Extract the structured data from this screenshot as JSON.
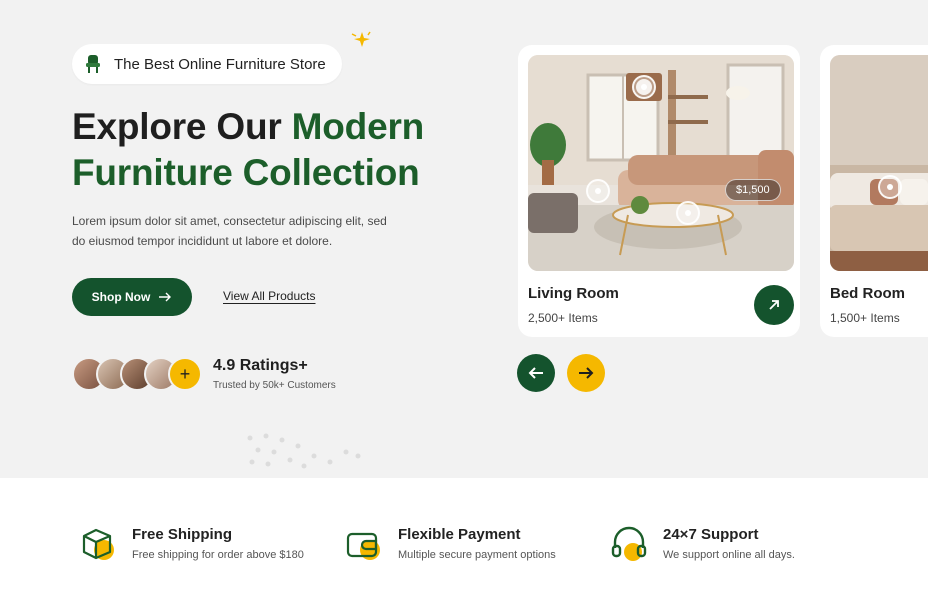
{
  "hero": {
    "badge": "The Best Online Furniture Store",
    "title_line1_plain": "Explore Our ",
    "title_line1_green": "Modern",
    "title_line2_green": "Furniture Collection",
    "description": "Lorem ipsum dolor sit amet, consectetur adipiscing elit, sed do eiusmod tempor incididunt ut labore et dolore.",
    "shop_button": "Shop Now",
    "view_link": "View All Products",
    "ratings_title": "4.9 Ratings+",
    "ratings_sub": "Trusted by 50k+ Customers",
    "avatar_plus": "+"
  },
  "cards": [
    {
      "name": "Living Room",
      "count": "2,500+ Items",
      "price_tag": "$1,500"
    },
    {
      "name": "Bed Room",
      "count": "1,500+ Items"
    }
  ],
  "features": [
    {
      "title": "Free Shipping",
      "desc": "Free shipping for order above $180",
      "icon": "box-icon"
    },
    {
      "title": "Flexible Payment",
      "desc": "Multiple secure payment options",
      "icon": "wallet-icon"
    },
    {
      "title": "24×7 Support",
      "desc": "We support online all days.",
      "icon": "headset-icon"
    }
  ],
  "colors": {
    "primary_green": "#14532d",
    "title_green": "#1c5e2a",
    "accent_yellow": "#f5b800",
    "hero_bg": "#f2f2f2"
  }
}
